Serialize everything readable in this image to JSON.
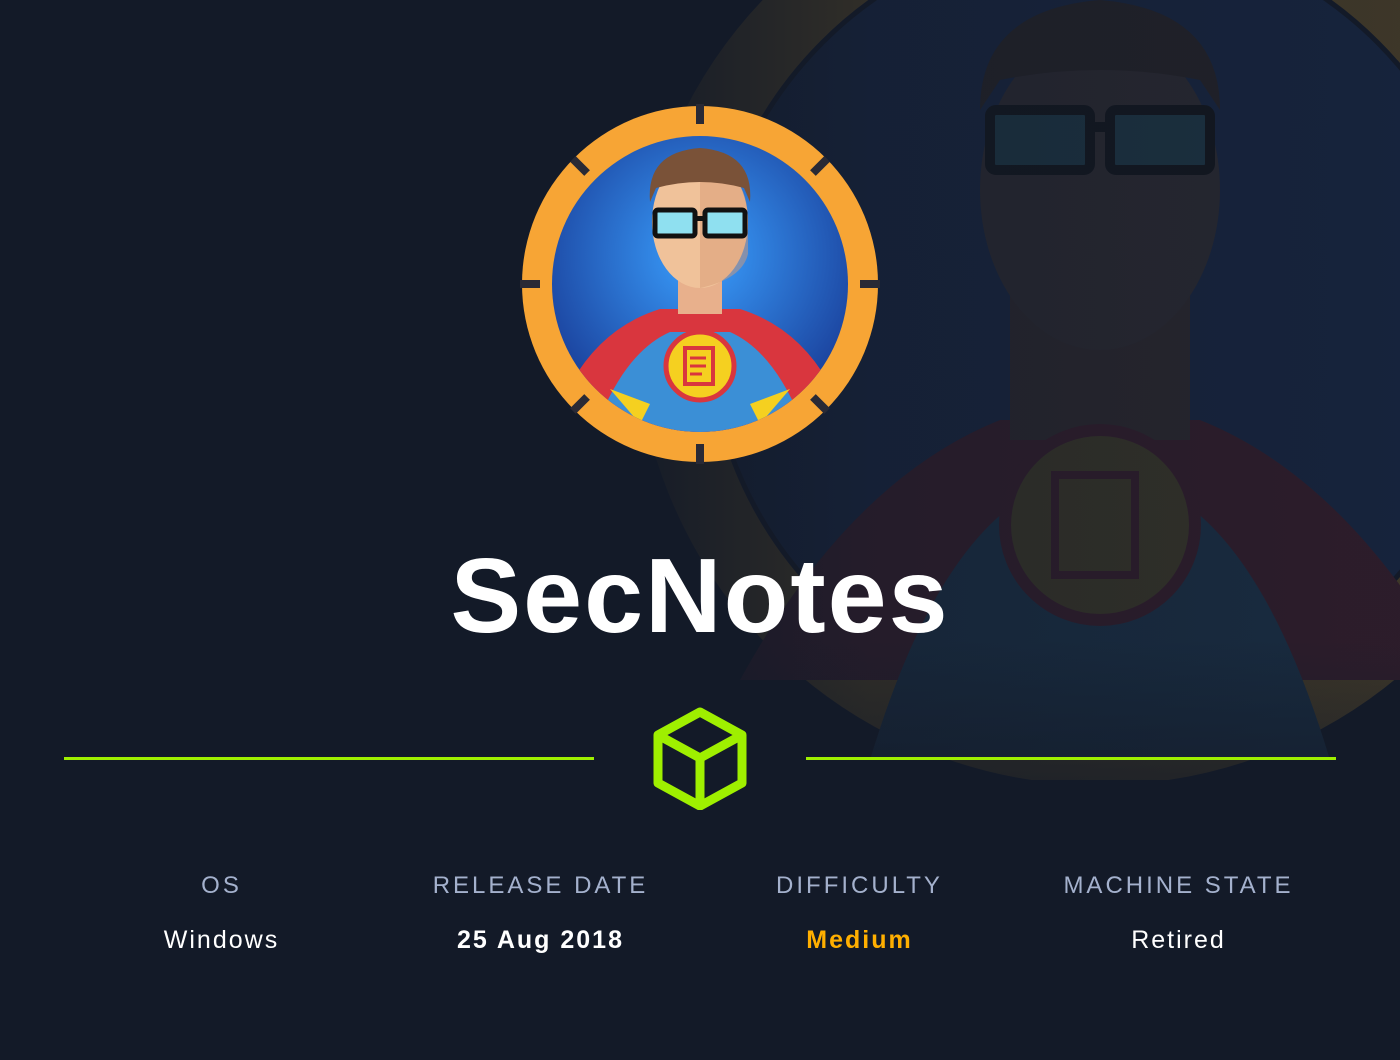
{
  "machine": {
    "name": "SecNotes"
  },
  "stats": [
    {
      "label": "OS",
      "value": "Windows"
    },
    {
      "label": "RELEASE DATE",
      "value": "25 Aug 2018"
    },
    {
      "label": "DIFFICULTY",
      "value": "Medium",
      "color": "#ffaf00"
    },
    {
      "label": "MACHINE STATE",
      "value": "Retired"
    }
  ],
  "colors": {
    "background": "#131a28",
    "accent_green": "#9fef00",
    "ring_orange": "#f7a535",
    "label_gray": "#a4b1cd",
    "difficulty_medium": "#ffaf00"
  },
  "icons": {
    "avatar": "superhero-notes-avatar",
    "divider_icon": "cube-icon"
  }
}
